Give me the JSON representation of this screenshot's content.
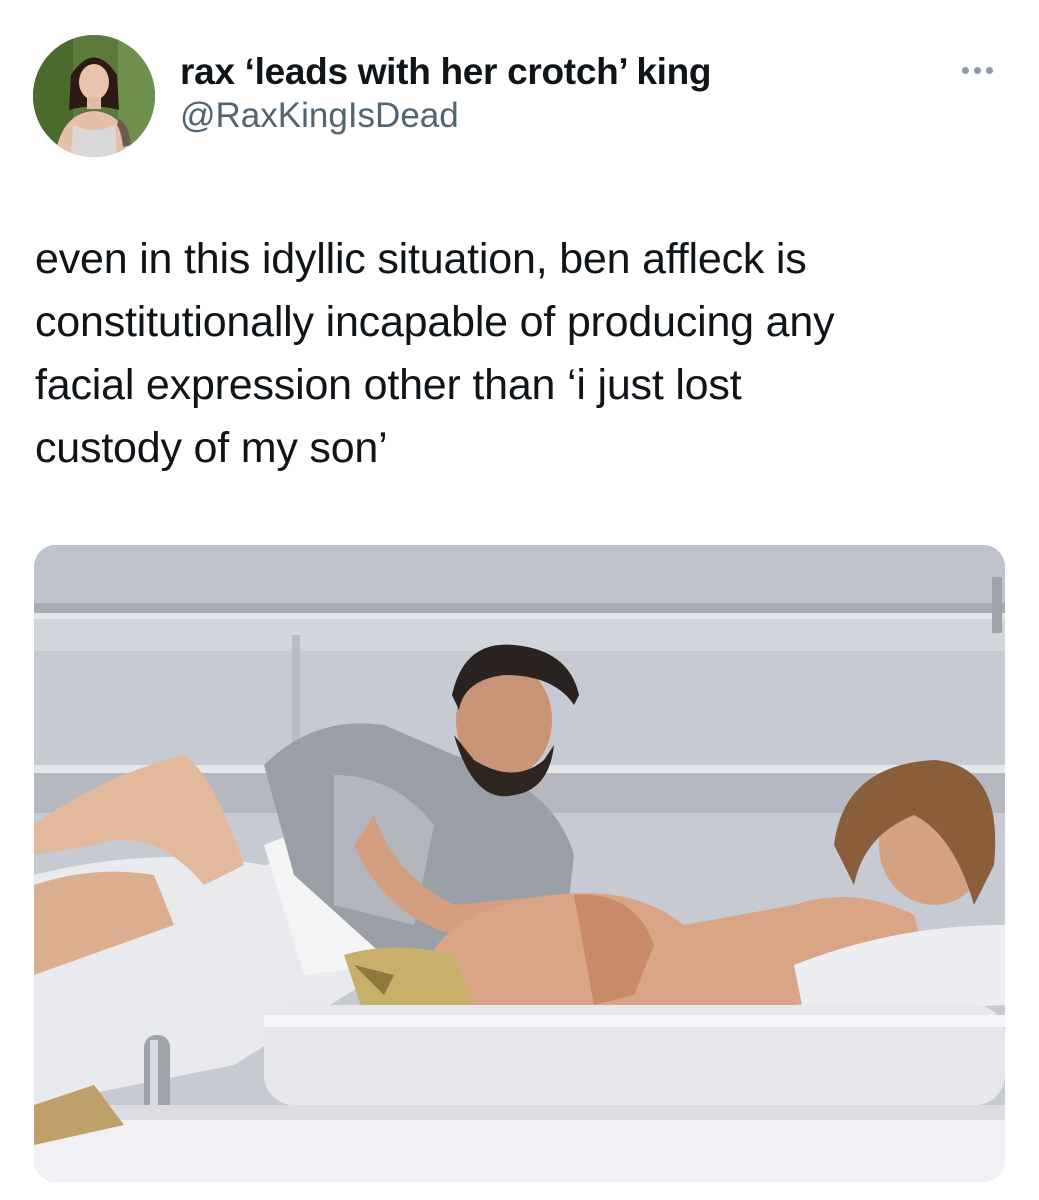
{
  "author": {
    "display_name": "rax ‘leads with her crotch’ king",
    "handle": "@RaxKingIsDead",
    "avatar_icon": "profile-photo"
  },
  "more_icon": "ellipsis-horizontal-icon",
  "tweet": {
    "text": "even in this idyllic situation, ben affleck is\nconstitutionally incapable of producing any\nfacial expression other than ‘i just lost\ncustody of my son’"
  },
  "media": {
    "kind": "photo",
    "subject": "man and woman on yacht deck"
  },
  "colors": {
    "text": "#0f1419",
    "secondary": "#536471",
    "background": "#ffffff"
  }
}
